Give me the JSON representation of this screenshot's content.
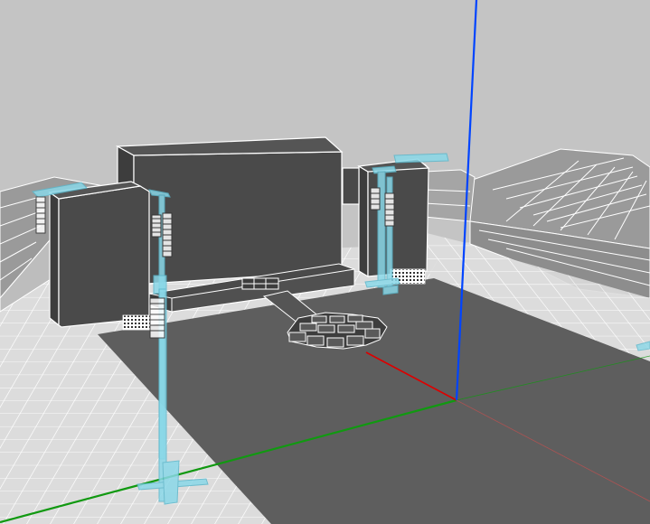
{
  "viewport": {
    "kind": "3d-wireframe-viewport"
  },
  "colors": {
    "background": "#c4c4c4",
    "grid_fill": "#dcdcdc",
    "grid_line": "#ffffff",
    "floor": "#5e5e5e",
    "solid_face": "#4a4a4a",
    "solid_face_dark": "#3d3d3d",
    "edge": "#ffffff",
    "stand": "#8ad8e8",
    "stand_edge": "#5cb8cc",
    "axis_x": "#dd0000",
    "axis_y": "#119911",
    "axis_z": "#0044ff",
    "seating": "#9a9a9a"
  },
  "icons": {
    "x-axis": "red-axis-line",
    "y-axis": "green-axis-line",
    "z-axis": "blue-axis-line"
  }
}
